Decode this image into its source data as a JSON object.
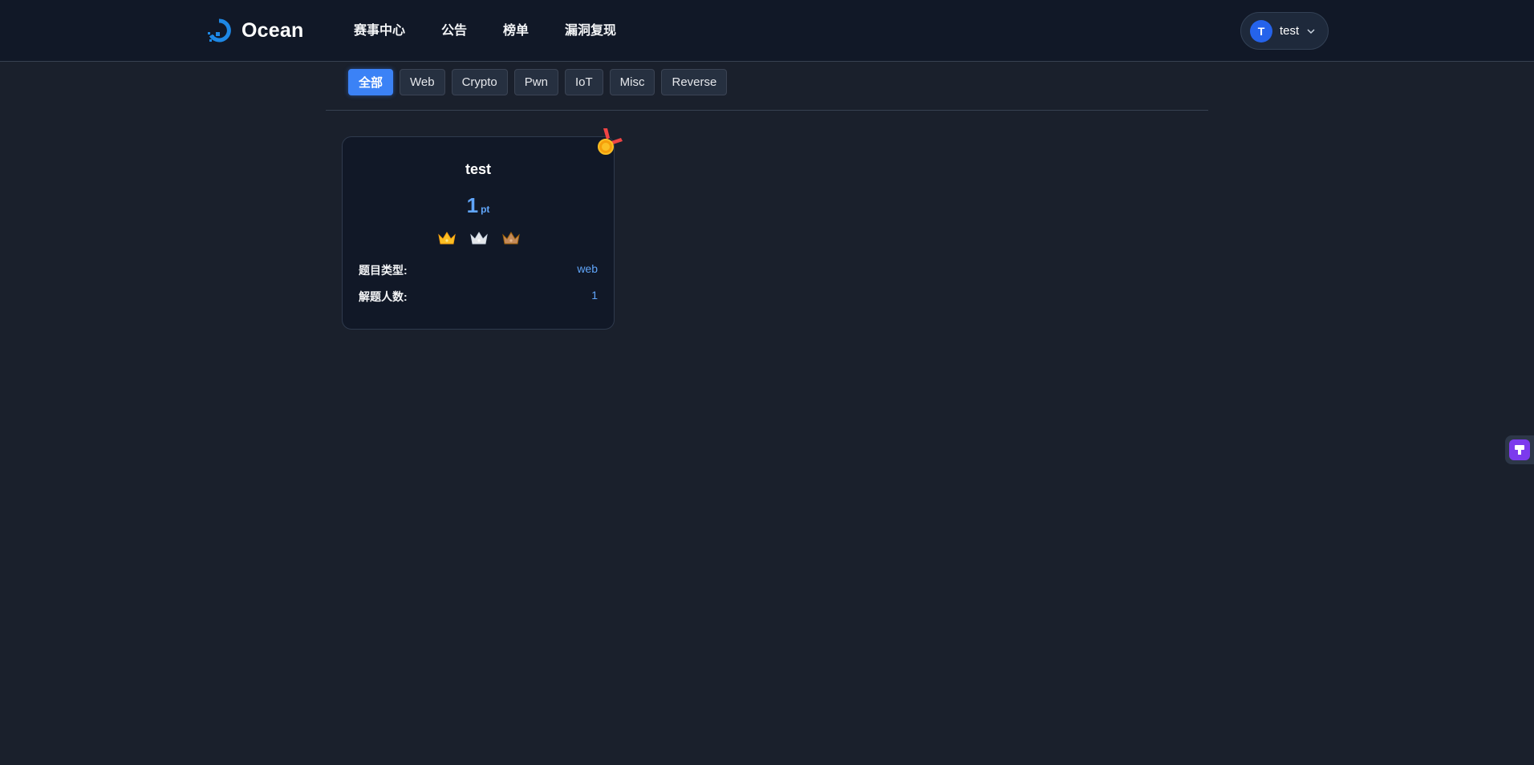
{
  "brand": {
    "name": "Ocean",
    "accent": "#1e88e5"
  },
  "nav": {
    "items": [
      {
        "label": "赛事中心"
      },
      {
        "label": "公告"
      },
      {
        "label": "榜单"
      },
      {
        "label": "漏洞复现"
      }
    ]
  },
  "user": {
    "initial": "T",
    "name": "test"
  },
  "filters": [
    {
      "label": "全部",
      "active": true
    },
    {
      "label": "Web"
    },
    {
      "label": "Crypto"
    },
    {
      "label": "Pwn"
    },
    {
      "label": "IoT"
    },
    {
      "label": "Misc"
    },
    {
      "label": "Reverse"
    }
  ],
  "challenge": {
    "title": "test",
    "score": "1",
    "unit": "pt",
    "crowns": [
      "gold-crown-icon",
      "silver-crown-icon",
      "bronze-crown-icon"
    ],
    "type_label": "题目类型:",
    "type_value": "web",
    "solves_label": "解题人数:",
    "solves_value": "1"
  }
}
